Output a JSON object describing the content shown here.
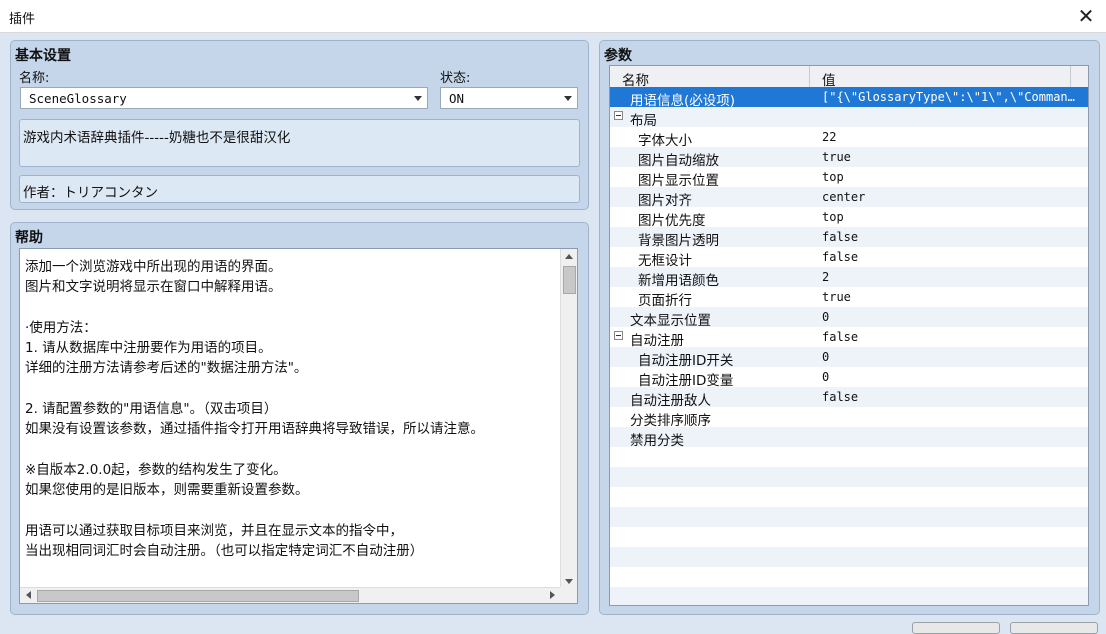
{
  "window": {
    "title": "插件"
  },
  "basic": {
    "title": "基本设置",
    "name_label": "名称:",
    "name_value": "SceneGlossary",
    "status_label": "状态:",
    "status_value": "ON",
    "description": "游戏内术语辞典插件-----奶糖也不是很甜汉化",
    "author": "作者：トリアコンタン"
  },
  "help": {
    "title": "帮助",
    "text": "添加一个浏览游戏中所出现的用语的界面。\n图片和文字说明将显示在窗口中解释用语。\n\n·使用方法：\n1. 请从数据库中注册要作为用语的项目。\n详细的注册方法请参考后述的\"数据注册方法\"。\n\n2. 请配置参数的\"用语信息\"。（双击项目）\n如果没有设置该参数，通过插件指令打开用语辞典将导致错误，所以请注意。\n\n※自版本2.0.0起，参数的结构发生了变化。\n如果您使用的是旧版本，则需要重新设置参数。\n\n用语可以通过获取目标项目来浏览，并且在显示文本的指令中，\n当出现相同词汇时会自动注册。（也可以指定特定词汇不自动注册）"
  },
  "params": {
    "title": "参数",
    "col_name": "名称",
    "col_value": "值",
    "rows": [
      {
        "name": "用语信息(必设项)",
        "value": "[\"{\\\"GlossaryType\\\":\\\"1\\\",\\\"Comman…",
        "level": 1,
        "selected": true,
        "toggle": false
      },
      {
        "name": "布局",
        "value": "",
        "level": 0,
        "selected": false,
        "toggle": true
      },
      {
        "name": "字体大小",
        "value": "22",
        "level": 2,
        "selected": false,
        "toggle": false
      },
      {
        "name": "图片自动缩放",
        "value": "true",
        "level": 2,
        "selected": false,
        "toggle": false
      },
      {
        "name": "图片显示位置",
        "value": "top",
        "level": 2,
        "selected": false,
        "toggle": false
      },
      {
        "name": "图片对齐",
        "value": "center",
        "level": 2,
        "selected": false,
        "toggle": false
      },
      {
        "name": "图片优先度",
        "value": "top",
        "level": 2,
        "selected": false,
        "toggle": false
      },
      {
        "name": "背景图片透明",
        "value": "false",
        "level": 2,
        "selected": false,
        "toggle": false
      },
      {
        "name": "无框设计",
        "value": "false",
        "level": 2,
        "selected": false,
        "toggle": false
      },
      {
        "name": "新增用语颜色",
        "value": "2",
        "level": 2,
        "selected": false,
        "toggle": false
      },
      {
        "name": "页面折行",
        "value": "true",
        "level": 2,
        "selected": false,
        "toggle": false
      },
      {
        "name": "文本显示位置",
        "value": "0",
        "level": 1,
        "selected": false,
        "toggle": false
      },
      {
        "name": "自动注册",
        "value": "false",
        "level": 0,
        "selected": false,
        "toggle": true
      },
      {
        "name": "自动注册ID开关",
        "value": "0",
        "level": 2,
        "selected": false,
        "toggle": false
      },
      {
        "name": "自动注册ID变量",
        "value": "0",
        "level": 2,
        "selected": false,
        "toggle": false
      },
      {
        "name": "自动注册敌人",
        "value": "false",
        "level": 1,
        "selected": false,
        "toggle": false
      },
      {
        "name": "分类排序顺序",
        "value": "",
        "level": 1,
        "selected": false,
        "toggle": false
      },
      {
        "name": "禁用分类",
        "value": "",
        "level": 1,
        "selected": false,
        "toggle": false
      }
    ],
    "empty_rows": 8
  }
}
